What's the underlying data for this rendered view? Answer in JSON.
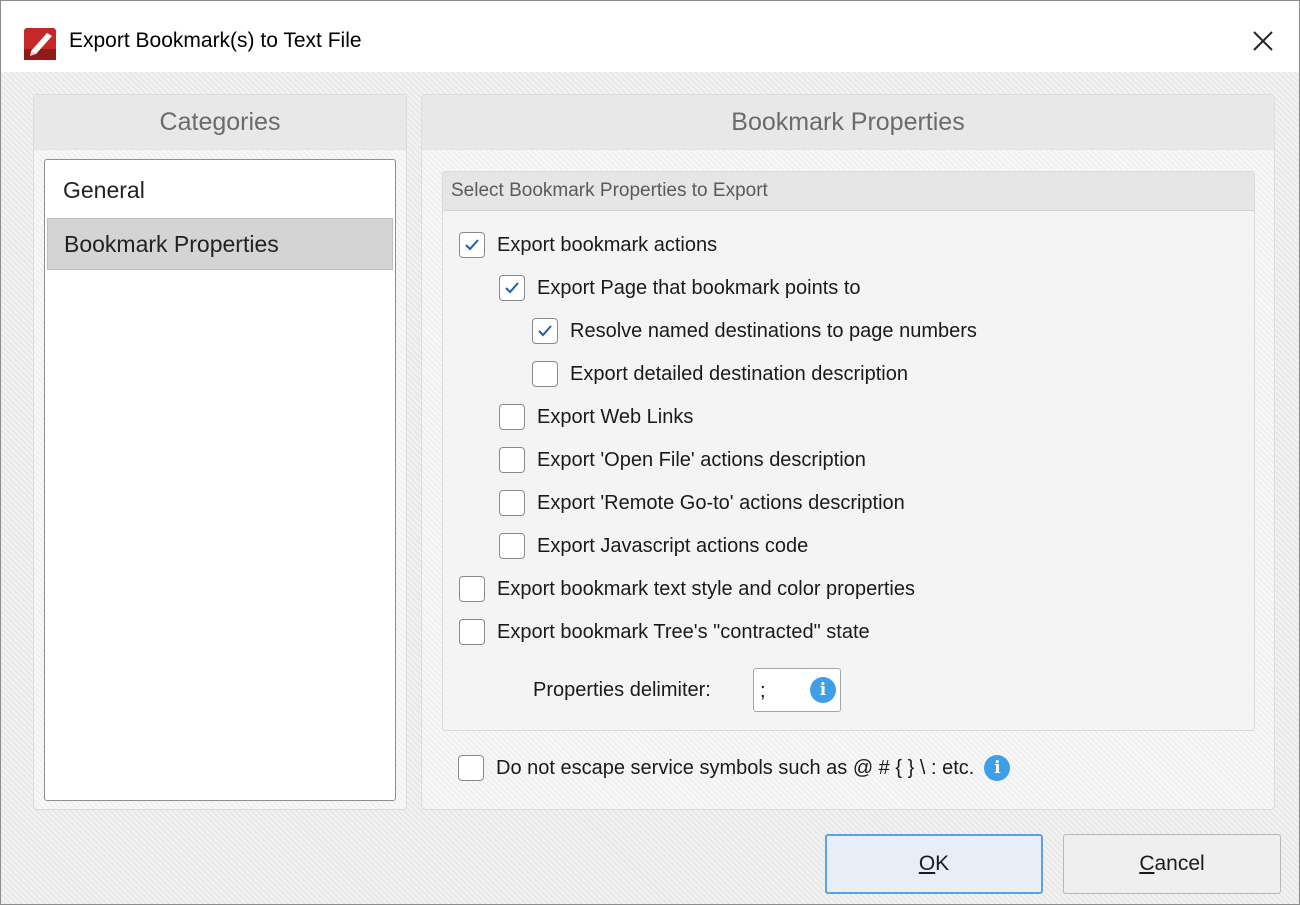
{
  "window": {
    "title": "Export Bookmark(s) to Text File",
    "close_glyph": "✕"
  },
  "categories": {
    "header": "Categories",
    "items": [
      {
        "label": "General",
        "selected": false
      },
      {
        "label": "Bookmark Properties",
        "selected": true
      }
    ]
  },
  "properties": {
    "header": "Bookmark Properties",
    "group_title": "Select Bookmark Properties to Export",
    "options": [
      {
        "label": "Export bookmark actions",
        "checked": true
      },
      {
        "label": "Export Page that bookmark points to",
        "checked": true
      },
      {
        "label": "Resolve named destinations to page numbers",
        "checked": true
      },
      {
        "label": "Export detailed destination description",
        "checked": false
      },
      {
        "label": "Export Web Links",
        "checked": false
      },
      {
        "label": "Export 'Open File' actions description",
        "checked": false
      },
      {
        "label": "Export 'Remote Go-to' actions description",
        "checked": false
      },
      {
        "label": "Export Javascript actions code",
        "checked": false
      },
      {
        "label": "Export bookmark text style and color properties",
        "checked": false
      },
      {
        "label": "Export bookmark Tree's \"contracted\" state",
        "checked": false
      }
    ],
    "delimiter_label": "Properties delimiter:",
    "delimiter_value": ";",
    "escape_option": {
      "label": "Do not escape service symbols such as @ # { } \\ : etc.",
      "checked": false
    }
  },
  "buttons": {
    "ok": {
      "mnemonic": "O",
      "rest": "K"
    },
    "cancel": {
      "mnemonic": "C",
      "rest": "ancel"
    }
  },
  "colors": {
    "accent": "#5aa3e0",
    "info_icon": "#3f9ee8",
    "check_mark": "#1f5fa8",
    "app_icon": "#c62828"
  },
  "icons": {
    "app": "pdf-editor-app-icon",
    "close": "close-icon",
    "check": "checkmark-icon",
    "info": "info-icon"
  }
}
